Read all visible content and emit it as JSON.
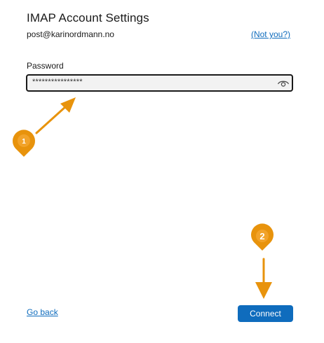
{
  "dialog": {
    "title": "IMAP Account Settings",
    "account_email": "post@karinordmann.no",
    "not_you_label": "(Not you?)"
  },
  "password": {
    "label": "Password",
    "value": "****************",
    "reveal_icon": "eye-icon"
  },
  "callouts": [
    {
      "number": "1",
      "color": "#e8930c"
    },
    {
      "number": "2",
      "color": "#e8930c"
    }
  ],
  "footer": {
    "back_label": "Go back",
    "connect_label": "Connect"
  },
  "colors": {
    "accent": "#0f6cbd",
    "callout": "#e8930c"
  }
}
